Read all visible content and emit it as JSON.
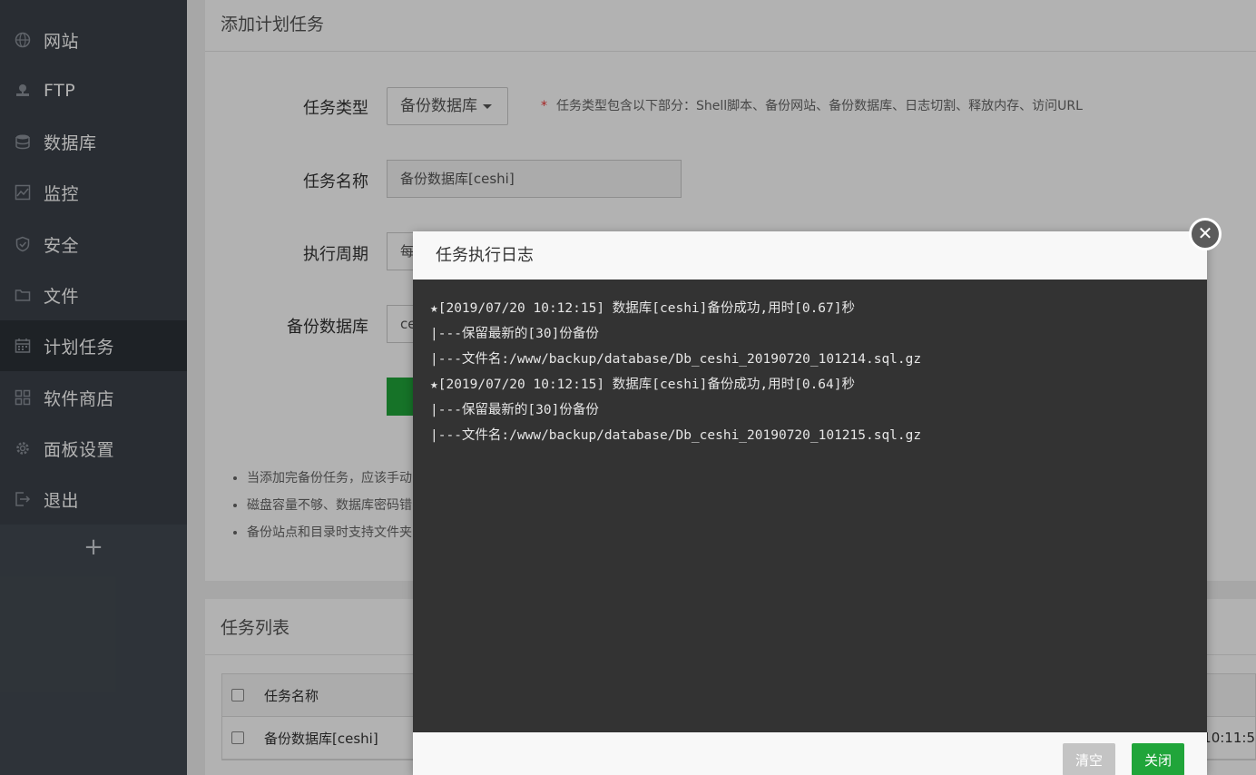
{
  "sidebar": {
    "items": [
      {
        "label": "网站",
        "icon": "globe-icon"
      },
      {
        "label": "FTP",
        "icon": "ftp-icon"
      },
      {
        "label": "数据库",
        "icon": "database-icon"
      },
      {
        "label": "监控",
        "icon": "monitor-icon"
      },
      {
        "label": "安全",
        "icon": "shield-icon"
      },
      {
        "label": "文件",
        "icon": "folder-icon"
      },
      {
        "label": "计划任务",
        "icon": "calendar-icon",
        "active": true
      },
      {
        "label": "软件商店",
        "icon": "grid-icon"
      },
      {
        "label": "面板设置",
        "icon": "gear-icon"
      },
      {
        "label": "退出",
        "icon": "logout-icon"
      }
    ],
    "add_symbol": "+"
  },
  "add_task": {
    "title": "添加计划任务",
    "type_label": "任务类型",
    "type_value": "备份数据库",
    "type_hint_star": "*",
    "type_hint": "任务类型包含以下部分：Shell脚本、备份网站、备份数据库、日志切割、释放内存、访问URL",
    "name_label": "任务名称",
    "name_value": "备份数据库[ceshi]",
    "period_label": "执行周期",
    "period_value_partial": "每",
    "db_label": "备份数据库",
    "db_value_partial": "ce",
    "notes": [
      "当添加完备份任务，应该手动",
      "磁盘容量不够、数据库密码错",
      "备份站点和目录时支持文件夹"
    ]
  },
  "task_list": {
    "title": "任务列表",
    "header_name": "任务名称",
    "rows": [
      {
        "name": "备份数据库[ceshi]",
        "time": "0 10:11:5"
      }
    ]
  },
  "dialog": {
    "title": "任务执行日志",
    "log_lines": [
      "★[2019/07/20 10:12:15] 数据库[ceshi]备份成功,用时[0.67]秒",
      "|---保留最新的[30]份备份",
      "|---文件名:/www/backup/database/Db_ceshi_20190720_101214.sql.gz",
      "★[2019/07/20 10:12:15] 数据库[ceshi]备份成功,用时[0.64]秒",
      "|---保留最新的[30]份备份",
      "|---文件名:/www/backup/database/Db_ceshi_20190720_101215.sql.gz"
    ],
    "clear_label": "清空",
    "close_label": "关闭",
    "close_x": "✕"
  },
  "colors": {
    "accent": "#20a53a",
    "sidebar_bg": "#3b4149",
    "sidebar_active": "#2c3137",
    "log_bg": "#333333"
  }
}
